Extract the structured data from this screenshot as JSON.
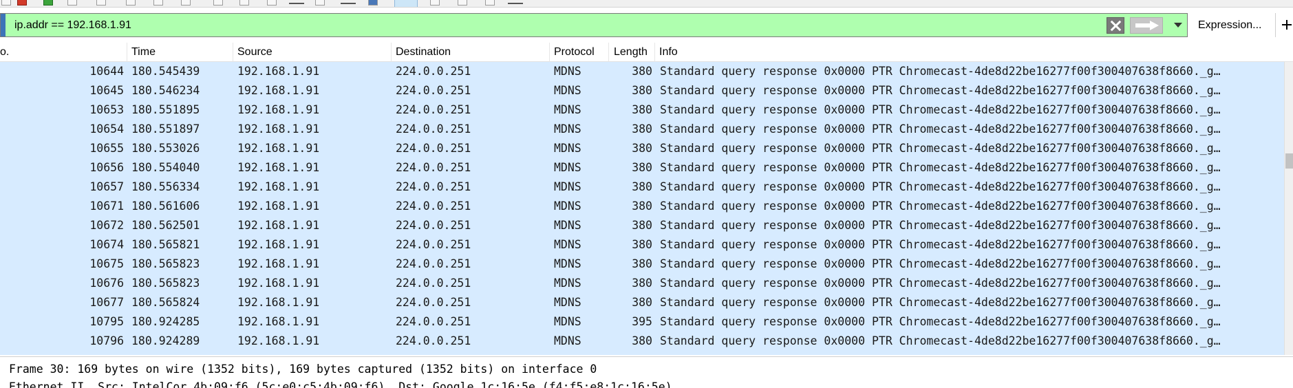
{
  "filter": {
    "value": "ip.addr == 192.168.1.91",
    "expression_label": "Expression...",
    "bg_color": "#afffaf"
  },
  "packet_list": {
    "columns": [
      "o.",
      "Time",
      "Source",
      "Destination",
      "Protocol",
      "Length",
      "Info"
    ],
    "selected_bg": "#d7ebff",
    "rows": [
      {
        "no": "10644",
        "time": "180.545439",
        "source": "192.168.1.91",
        "destination": "224.0.0.251",
        "protocol": "MDNS",
        "length": "380",
        "info": "Standard query response 0x0000 PTR Chromecast-4de8d22be16277f00f300407638f8660._g…"
      },
      {
        "no": "10645",
        "time": "180.546234",
        "source": "192.168.1.91",
        "destination": "224.0.0.251",
        "protocol": "MDNS",
        "length": "380",
        "info": "Standard query response 0x0000 PTR Chromecast-4de8d22be16277f00f300407638f8660._g…"
      },
      {
        "no": "10653",
        "time": "180.551895",
        "source": "192.168.1.91",
        "destination": "224.0.0.251",
        "protocol": "MDNS",
        "length": "380",
        "info": "Standard query response 0x0000 PTR Chromecast-4de8d22be16277f00f300407638f8660._g…"
      },
      {
        "no": "10654",
        "time": "180.551897",
        "source": "192.168.1.91",
        "destination": "224.0.0.251",
        "protocol": "MDNS",
        "length": "380",
        "info": "Standard query response 0x0000 PTR Chromecast-4de8d22be16277f00f300407638f8660._g…"
      },
      {
        "no": "10655",
        "time": "180.553026",
        "source": "192.168.1.91",
        "destination": "224.0.0.251",
        "protocol": "MDNS",
        "length": "380",
        "info": "Standard query response 0x0000 PTR Chromecast-4de8d22be16277f00f300407638f8660._g…"
      },
      {
        "no": "10656",
        "time": "180.554040",
        "source": "192.168.1.91",
        "destination": "224.0.0.251",
        "protocol": "MDNS",
        "length": "380",
        "info": "Standard query response 0x0000 PTR Chromecast-4de8d22be16277f00f300407638f8660._g…"
      },
      {
        "no": "10657",
        "time": "180.556334",
        "source": "192.168.1.91",
        "destination": "224.0.0.251",
        "protocol": "MDNS",
        "length": "380",
        "info": "Standard query response 0x0000 PTR Chromecast-4de8d22be16277f00f300407638f8660._g…"
      },
      {
        "no": "10671",
        "time": "180.561606",
        "source": "192.168.1.91",
        "destination": "224.0.0.251",
        "protocol": "MDNS",
        "length": "380",
        "info": "Standard query response 0x0000 PTR Chromecast-4de8d22be16277f00f300407638f8660._g…"
      },
      {
        "no": "10672",
        "time": "180.562501",
        "source": "192.168.1.91",
        "destination": "224.0.0.251",
        "protocol": "MDNS",
        "length": "380",
        "info": "Standard query response 0x0000 PTR Chromecast-4de8d22be16277f00f300407638f8660._g…"
      },
      {
        "no": "10674",
        "time": "180.565821",
        "source": "192.168.1.91",
        "destination": "224.0.0.251",
        "protocol": "MDNS",
        "length": "380",
        "info": "Standard query response 0x0000 PTR Chromecast-4de8d22be16277f00f300407638f8660._g…"
      },
      {
        "no": "10675",
        "time": "180.565823",
        "source": "192.168.1.91",
        "destination": "224.0.0.251",
        "protocol": "MDNS",
        "length": "380",
        "info": "Standard query response 0x0000 PTR Chromecast-4de8d22be16277f00f300407638f8660._g…"
      },
      {
        "no": "10676",
        "time": "180.565823",
        "source": "192.168.1.91",
        "destination": "224.0.0.251",
        "protocol": "MDNS",
        "length": "380",
        "info": "Standard query response 0x0000 PTR Chromecast-4de8d22be16277f00f300407638f8660._g…"
      },
      {
        "no": "10677",
        "time": "180.565824",
        "source": "192.168.1.91",
        "destination": "224.0.0.251",
        "protocol": "MDNS",
        "length": "380",
        "info": "Standard query response 0x0000 PTR Chromecast-4de8d22be16277f00f300407638f8660._g…"
      },
      {
        "no": "10795",
        "time": "180.924285",
        "source": "192.168.1.91",
        "destination": "224.0.0.251",
        "protocol": "MDNS",
        "length": "395",
        "info": "Standard query response 0x0000 PTR Chromecast-4de8d22be16277f00f300407638f8660._g…"
      },
      {
        "no": "10796",
        "time": "180.924289",
        "source": "192.168.1.91",
        "destination": "224.0.0.251",
        "protocol": "MDNS",
        "length": "380",
        "info": "Standard query response 0x0000 PTR Chromecast-4de8d22be16277f00f300407638f8660._g…"
      }
    ]
  },
  "details": {
    "lines": [
      "Frame 30: 169 bytes on wire (1352 bits), 169 bytes captured (1352 bits) on interface 0",
      "Ethernet II, Src: IntelCor_4b:09:f6 (5c:e0:c5:4b:09:f6), Dst: Google_1c:16:5e (f4:f5:e8:1c:16:5e)"
    ]
  }
}
